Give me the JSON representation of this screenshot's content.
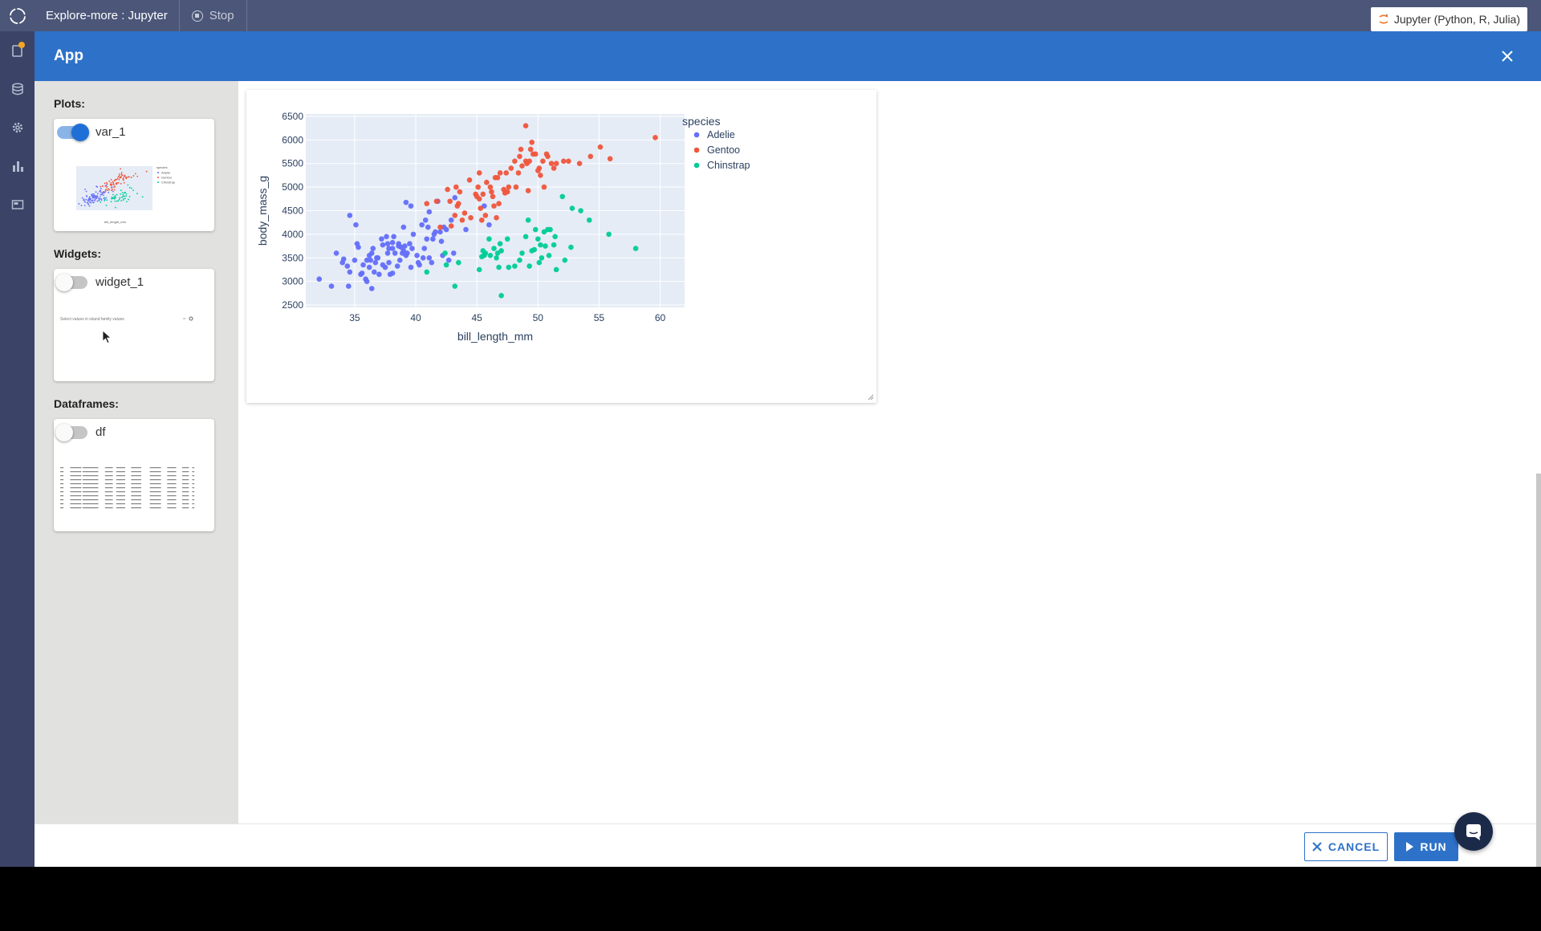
{
  "topbar": {
    "project_title": "Explore-more : Jupyter",
    "stop_label": "Stop",
    "kernel_label": "Jupyter (Python, R, Julia)"
  },
  "modal": {
    "title": "App"
  },
  "sidebar": {
    "plots_title": "Plots:",
    "plot_item": {
      "label": "var_1",
      "enabled": true
    },
    "widgets_title": "Widgets:",
    "widget_item": {
      "label": "widget_1",
      "enabled": false,
      "preview_text": "Select values in island family values"
    },
    "dataframes_title": "Dataframes:",
    "df_item": {
      "label": "df",
      "enabled": false
    }
  },
  "footer": {
    "cancel_label": "CANCEL",
    "run_label": "RUN"
  },
  "colors": {
    "accent": "#2d72c8",
    "topbar": "#4b5678",
    "rail": "#3b4466",
    "adelie": "#636efa",
    "gentoo": "#ef553b",
    "chinstrap": "#00cc96"
  },
  "chart_data": {
    "type": "scatter",
    "xlabel": "bill_length_mm",
    "ylabel": "body_mass_g",
    "xlim": [
      31,
      62
    ],
    "ylim": [
      2450,
      6550
    ],
    "xticks": [
      35,
      40,
      45,
      50,
      55,
      60
    ],
    "yticks": [
      2500,
      3000,
      3500,
      4000,
      4500,
      5000,
      5500,
      6000,
      6500
    ],
    "grid": true,
    "legend_title": "species",
    "legend_position": "right",
    "series": [
      {
        "name": "Adelie",
        "color": "#636efa",
        "points": [
          [
            32.1,
            3050
          ],
          [
            33.1,
            2900
          ],
          [
            33.5,
            3600
          ],
          [
            34.0,
            3400
          ],
          [
            34.1,
            3475
          ],
          [
            34.4,
            3325
          ],
          [
            34.5,
            2900
          ],
          [
            34.6,
            4400
          ],
          [
            34.6,
            3200
          ],
          [
            35.0,
            3450
          ],
          [
            35.1,
            4200
          ],
          [
            35.2,
            3800
          ],
          [
            35.3,
            3725
          ],
          [
            35.5,
            3150
          ],
          [
            35.6,
            3175
          ],
          [
            35.7,
            3350
          ],
          [
            35.9,
            3050
          ],
          [
            36.0,
            3450
          ],
          [
            36.0,
            3000
          ],
          [
            36.2,
            3550
          ],
          [
            36.2,
            3300
          ],
          [
            36.3,
            3450
          ],
          [
            36.4,
            2850
          ],
          [
            36.4,
            3600
          ],
          [
            36.5,
            3700
          ],
          [
            36.6,
            3200
          ],
          [
            36.7,
            3400
          ],
          [
            36.8,
            3500
          ],
          [
            36.9,
            3500
          ],
          [
            37.0,
            3150
          ],
          [
            37.2,
            3900
          ],
          [
            37.3,
            3775
          ],
          [
            37.3,
            3350
          ],
          [
            37.5,
            3300
          ],
          [
            37.6,
            3950
          ],
          [
            37.7,
            3800
          ],
          [
            37.7,
            3600
          ],
          [
            37.8,
            3700
          ],
          [
            37.8,
            3400
          ],
          [
            37.9,
            3150
          ],
          [
            38.1,
            3700
          ],
          [
            38.1,
            3825
          ],
          [
            38.1,
            3175
          ],
          [
            38.2,
            3950
          ],
          [
            38.3,
            3600
          ],
          [
            38.5,
            3325
          ],
          [
            38.6,
            3800
          ],
          [
            38.6,
            3750
          ],
          [
            38.7,
            3450
          ],
          [
            38.8,
            3725
          ],
          [
            38.9,
            3600
          ],
          [
            39.0,
            4150
          ],
          [
            39.0,
            3650
          ],
          [
            39.1,
            3750
          ],
          [
            39.2,
            4675
          ],
          [
            39.2,
            3550
          ],
          [
            39.3,
            3600
          ],
          [
            39.5,
            3800
          ],
          [
            39.6,
            4600
          ],
          [
            39.6,
            3300
          ],
          [
            39.7,
            3700
          ],
          [
            39.8,
            4000
          ],
          [
            40.1,
            3550
          ],
          [
            40.2,
            3400
          ],
          [
            40.3,
            3350
          ],
          [
            40.5,
            4200
          ],
          [
            40.6,
            3500
          ],
          [
            40.7,
            3700
          ],
          [
            40.8,
            4300
          ],
          [
            40.9,
            3900
          ],
          [
            41.0,
            4150
          ],
          [
            41.1,
            3500
          ],
          [
            41.1,
            4475
          ],
          [
            41.3,
            3400
          ],
          [
            41.4,
            3900
          ],
          [
            41.5,
            4000
          ],
          [
            41.6,
            4050
          ],
          [
            41.8,
            4700
          ],
          [
            42.0,
            4050
          ],
          [
            42.1,
            3850
          ],
          [
            42.2,
            3550
          ],
          [
            42.3,
            4150
          ],
          [
            42.5,
            4100
          ],
          [
            42.7,
            3450
          ],
          [
            42.9,
            4300
          ],
          [
            43.1,
            3600
          ],
          [
            43.2,
            4775
          ],
          [
            44.1,
            4100
          ],
          [
            45.6,
            4600
          ],
          [
            46.0,
            4200
          ]
        ]
      },
      {
        "name": "Gentoo",
        "color": "#ef553b",
        "points": [
          [
            40.9,
            4650
          ],
          [
            41.7,
            4700
          ],
          [
            42.0,
            4150
          ],
          [
            42.6,
            4950
          ],
          [
            42.8,
            4700
          ],
          [
            42.9,
            4175
          ],
          [
            43.2,
            4400
          ],
          [
            43.3,
            5000
          ],
          [
            43.4,
            4600
          ],
          [
            43.5,
            4650
          ],
          [
            43.6,
            4900
          ],
          [
            43.8,
            4300
          ],
          [
            44.0,
            4450
          ],
          [
            44.4,
            5150
          ],
          [
            44.5,
            4350
          ],
          [
            44.9,
            4850
          ],
          [
            45.0,
            4800
          ],
          [
            45.1,
            5000
          ],
          [
            45.2,
            4750
          ],
          [
            45.2,
            5300
          ],
          [
            45.3,
            4550
          ],
          [
            45.4,
            4300
          ],
          [
            45.5,
            4850
          ],
          [
            45.7,
            4400
          ],
          [
            45.8,
            5100
          ],
          [
            46.1,
            5000
          ],
          [
            46.2,
            4900
          ],
          [
            46.3,
            4800
          ],
          [
            46.4,
            4600
          ],
          [
            46.5,
            5200
          ],
          [
            46.6,
            4350
          ],
          [
            46.7,
            5200
          ],
          [
            46.8,
            4650
          ],
          [
            46.9,
            5300
          ],
          [
            47.2,
            4950
          ],
          [
            47.3,
            4875
          ],
          [
            47.4,
            5300
          ],
          [
            47.5,
            4900
          ],
          [
            47.6,
            5000
          ],
          [
            47.8,
            5400
          ],
          [
            48.1,
            5550
          ],
          [
            48.2,
            5000
          ],
          [
            48.4,
            5300
          ],
          [
            48.5,
            5650
          ],
          [
            48.6,
            5800
          ],
          [
            48.7,
            5450
          ],
          [
            49.0,
            5550
          ],
          [
            49.1,
            5500
          ],
          [
            49.2,
            4925
          ],
          [
            49.3,
            5550
          ],
          [
            49.4,
            5800
          ],
          [
            49.5,
            5950
          ],
          [
            49.6,
            5700
          ],
          [
            49.8,
            5700
          ],
          [
            50.0,
            5350
          ],
          [
            50.1,
            5400
          ],
          [
            50.2,
            5250
          ],
          [
            50.4,
            5550
          ],
          [
            50.5,
            5000
          ],
          [
            50.7,
            5700
          ],
          [
            50.8,
            5650
          ],
          [
            51.1,
            5500
          ],
          [
            51.3,
            5400
          ],
          [
            51.5,
            5500
          ],
          [
            52.1,
            5550
          ],
          [
            52.5,
            5550
          ],
          [
            53.4,
            5500
          ],
          [
            54.3,
            5650
          ],
          [
            55.1,
            5850
          ],
          [
            55.9,
            5600
          ],
          [
            59.6,
            6050
          ],
          [
            49.0,
            6300
          ]
        ]
      },
      {
        "name": "Chinstrap",
        "color": "#00cc96",
        "points": [
          [
            40.9,
            3200
          ],
          [
            42.4,
            3600
          ],
          [
            42.5,
            3350
          ],
          [
            43.2,
            2900
          ],
          [
            43.5,
            3400
          ],
          [
            45.2,
            3250
          ],
          [
            45.4,
            3525
          ],
          [
            45.5,
            3650
          ],
          [
            45.6,
            3550
          ],
          [
            45.7,
            3600
          ],
          [
            46.0,
            3900
          ],
          [
            46.1,
            3550
          ],
          [
            46.4,
            3700
          ],
          [
            46.6,
            3500
          ],
          [
            46.7,
            3600
          ],
          [
            46.8,
            3300
          ],
          [
            46.9,
            3800
          ],
          [
            47.0,
            3650
          ],
          [
            47.5,
            3900
          ],
          [
            47.6,
            3300
          ],
          [
            48.1,
            3325
          ],
          [
            48.5,
            3450
          ],
          [
            48.7,
            3600
          ],
          [
            49.0,
            3950
          ],
          [
            49.2,
            4300
          ],
          [
            49.3,
            3325
          ],
          [
            49.5,
            3650
          ],
          [
            49.7,
            3675
          ],
          [
            49.8,
            4100
          ],
          [
            50.0,
            3900
          ],
          [
            50.1,
            3400
          ],
          [
            50.2,
            3775
          ],
          [
            50.3,
            3500
          ],
          [
            50.5,
            4050
          ],
          [
            50.6,
            3750
          ],
          [
            50.8,
            4100
          ],
          [
            50.9,
            3550
          ],
          [
            51.0,
            4100
          ],
          [
            51.3,
            3775
          ],
          [
            51.4,
            3950
          ],
          [
            51.5,
            3250
          ],
          [
            52.0,
            4800
          ],
          [
            52.2,
            3450
          ],
          [
            52.7,
            3725
          ],
          [
            52.8,
            4550
          ],
          [
            53.5,
            4500
          ],
          [
            54.2,
            4300
          ],
          [
            55.8,
            4000
          ],
          [
            58.0,
            3700
          ],
          [
            47.0,
            2700
          ]
        ]
      }
    ]
  }
}
